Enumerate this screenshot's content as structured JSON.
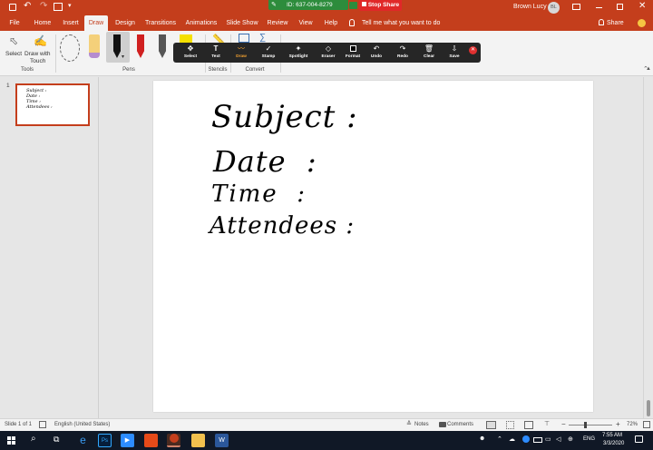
{
  "titlebar": {
    "zoom_id": "ID: 637-004-8279",
    "stop_share": "Stop Share",
    "user_name": "Brown Lucy",
    "user_initials": "BL"
  },
  "tabs": [
    "File",
    "Home",
    "Insert",
    "Draw",
    "Design",
    "Transitions",
    "Animations",
    "Slide Show",
    "Review",
    "View",
    "Help"
  ],
  "active_tab": "Draw",
  "tell_me": "Tell me what you want to do",
  "share": "Share",
  "ribbon": {
    "select": "Select",
    "draw_with_touch_1": "Draw with",
    "draw_with_touch_2": "Touch",
    "groups": {
      "tools": "Tools",
      "pens": "Pens",
      "stencils": "Stencils",
      "convert": "Convert"
    }
  },
  "annotation_toolbar": [
    {
      "label": "Select",
      "icon": "move-icon"
    },
    {
      "label": "Text",
      "icon": "text-icon"
    },
    {
      "label": "Draw",
      "icon": "draw-icon"
    },
    {
      "label": "Stamp",
      "icon": "check-icon"
    },
    {
      "label": "Spotlight",
      "icon": "spotlight-icon"
    },
    {
      "label": "Eraser",
      "icon": "eraser-icon"
    },
    {
      "label": "Format",
      "icon": "format-icon"
    },
    {
      "label": "Undo",
      "icon": "undo-icon"
    },
    {
      "label": "Redo",
      "icon": "redo-icon"
    },
    {
      "label": "Clear",
      "icon": "trash-icon"
    },
    {
      "label": "Save",
      "icon": "save-icon"
    }
  ],
  "active_tool": "Draw",
  "slide_number": "1",
  "slide_lines": [
    "Subject :",
    "Date  :",
    "Time  :",
    "Attendees :"
  ],
  "status": {
    "slide_of": "Slide 1 of 1",
    "language": "English (United States)",
    "notes": "Notes",
    "comments": "Comments",
    "zoom": "72%"
  },
  "taskbar": {
    "time": "7:55 AM",
    "date": "3/3/2020",
    "lang": "ENG"
  },
  "colors": {
    "accent": "#c43e1c",
    "zoom_green": "#2d8c3c",
    "stop_red": "#e02828",
    "toolbar_bg": "#262626",
    "active_tool": "#f0a030"
  }
}
